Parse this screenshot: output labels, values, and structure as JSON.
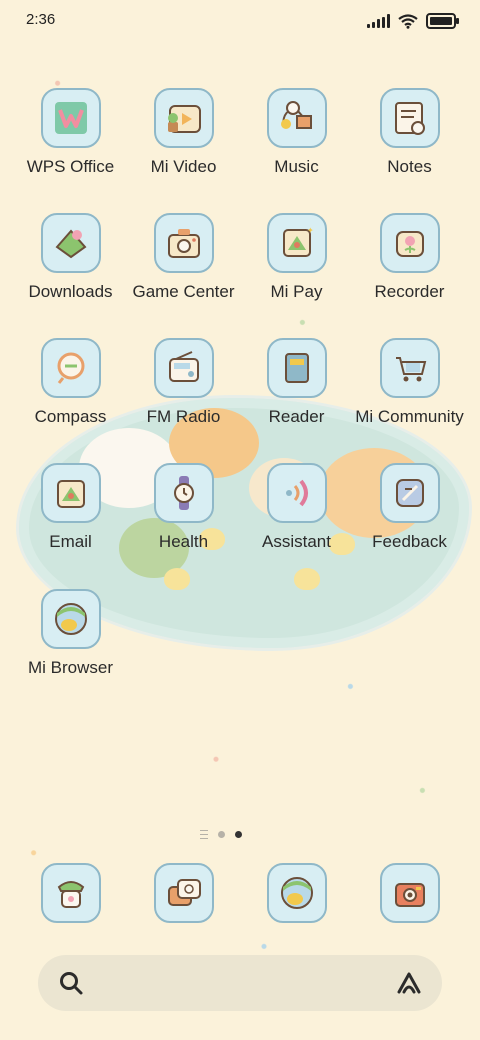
{
  "status_bar": {
    "time": "2:36",
    "icons": [
      "signal-icon",
      "wifi-icon",
      "battery-icon"
    ]
  },
  "apps": [
    {
      "label": "WPS Office",
      "icon": "wps-office-icon"
    },
    {
      "label": "Mi Video",
      "icon": "mi-video-icon"
    },
    {
      "label": "Music",
      "icon": "music-icon"
    },
    {
      "label": "Notes",
      "icon": "notes-icon"
    },
    {
      "label": "Downloads",
      "icon": "downloads-icon"
    },
    {
      "label": "Game Center",
      "icon": "game-center-icon"
    },
    {
      "label": "Mi Pay",
      "icon": "mi-pay-icon"
    },
    {
      "label": "Recorder",
      "icon": "recorder-icon"
    },
    {
      "label": "Compass",
      "icon": "compass-icon"
    },
    {
      "label": "FM Radio",
      "icon": "fm-radio-icon"
    },
    {
      "label": "Reader",
      "icon": "reader-icon"
    },
    {
      "label": "Mi Community",
      "icon": "mi-community-icon"
    },
    {
      "label": "Email",
      "icon": "email-icon"
    },
    {
      "label": "Health",
      "icon": "health-icon"
    },
    {
      "label": "Assistant",
      "icon": "assistant-icon"
    },
    {
      "label": "Feedback",
      "icon": "feedback-icon"
    },
    {
      "label": "Mi Browser",
      "icon": "mi-browser-icon"
    }
  ],
  "page_indicator": {
    "total": 2,
    "active": 2
  },
  "dock": [
    {
      "icon": "phone-icon"
    },
    {
      "icon": "messages-icon"
    },
    {
      "icon": "browser-icon"
    },
    {
      "icon": "camera-icon"
    }
  ],
  "search_bar": {
    "icons": [
      "search-icon",
      "assistant-logo-icon"
    ]
  },
  "colors": {
    "wallpaper": "#fbf2da",
    "icon_background": "#d8eef3",
    "icon_border": "#8fb8c8",
    "label_text": "#2b2b2b"
  }
}
